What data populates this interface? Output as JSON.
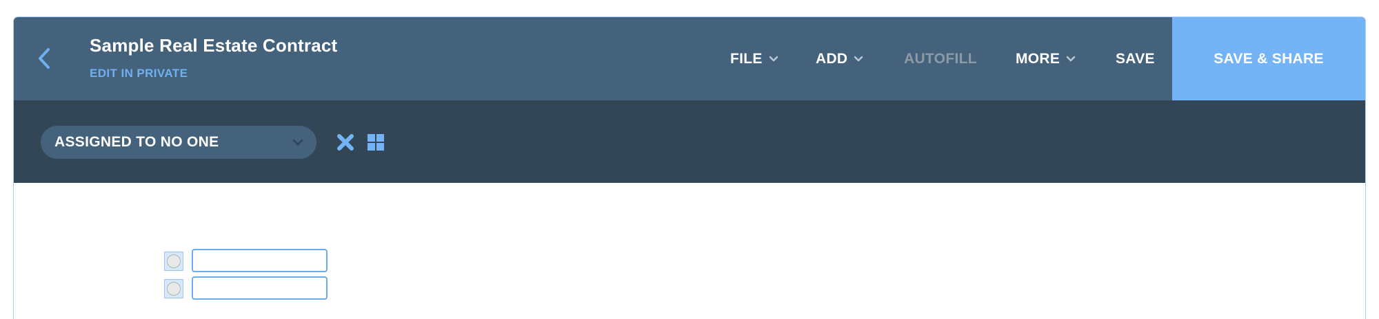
{
  "header": {
    "title": "Sample Real Estate Contract",
    "subtitle": "EDIT IN PRIVATE",
    "back_icon": "chevron-left-icon",
    "menu": {
      "file": "FILE",
      "add": "ADD",
      "autofill": "AUTOFILL",
      "more": "MORE",
      "save": "SAVE"
    },
    "share_button": "SAVE & SHARE"
  },
  "toolbar": {
    "assignee": "ASSIGNED TO NO ONE",
    "icons": [
      "close-icon",
      "grid-icon"
    ]
  },
  "document": {
    "fields": [
      {
        "type": "radio",
        "value": ""
      },
      {
        "type": "text",
        "value": ""
      },
      {
        "type": "radio",
        "value": ""
      },
      {
        "type": "text",
        "value": ""
      }
    ]
  },
  "colors": {
    "header_bg": "#44627b",
    "toolbar_bg": "#334656",
    "accent": "#74b3f5",
    "link": "#6fb0f2",
    "disabled_text": "#8d9aa6"
  }
}
